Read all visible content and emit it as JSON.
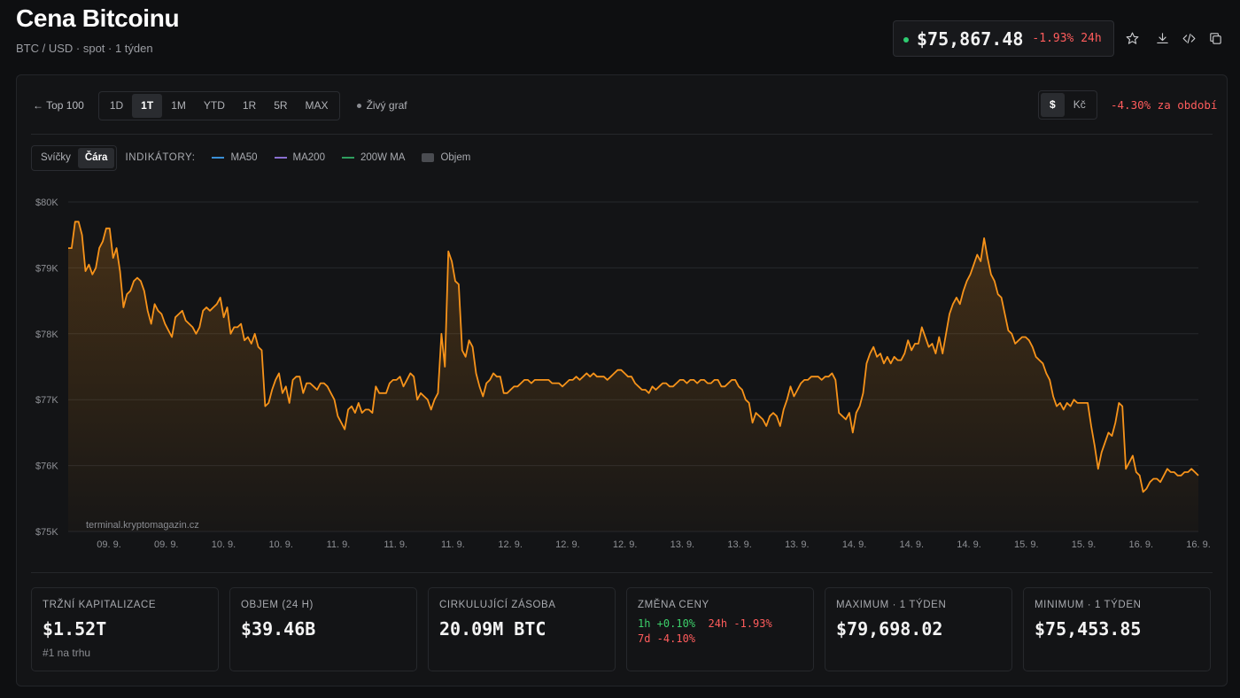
{
  "header": {
    "title": "Cena Bitcoinu",
    "subtitle": "BTC / USD · spot · 1 týden",
    "price": "$75,867.48",
    "change_24h": "-1.93% 24h"
  },
  "toolbar": {
    "back_label": "← Top 100",
    "ranges": [
      "1D",
      "1T",
      "1M",
      "YTD",
      "1R",
      "5R",
      "MAX"
    ],
    "active_range": "1T",
    "live_label": "Živý graf",
    "currencies": [
      "$",
      "Kč"
    ],
    "active_currency": "$",
    "period_change": "-4.30% za období"
  },
  "chart_toolbar": {
    "modes": [
      "Svíčky",
      "Čára"
    ],
    "active_mode": "Čára",
    "indicators_label": "INDIKÁTORY:",
    "indicators": [
      {
        "name": "MA50",
        "color": "#3a8fd6"
      },
      {
        "name": "MA200",
        "color": "#8a6fd0"
      },
      {
        "name": "200W MA",
        "color": "#2e9e5e"
      },
      {
        "name": "Objem",
        "color": "#4a4c51"
      }
    ]
  },
  "colors": {
    "line": "#f7931a",
    "accent_positive": "#3ccf6a",
    "accent_negative": "#ff5c5c"
  },
  "chart_data": {
    "type": "line",
    "watermark": "terminal.kryptomagazin.cz",
    "ylim": [
      75000,
      80000
    ],
    "y_ticks": [
      80000,
      79000,
      78000,
      77000,
      76000,
      75000
    ],
    "y_tick_labels": [
      "$80K",
      "$79K",
      "$78K",
      "$77K",
      "$76K",
      "$75K"
    ],
    "x_tick_labels": [
      "09. 9.",
      "09. 9.",
      "10. 9.",
      "10. 9.",
      "11. 9.",
      "11. 9.",
      "11. 9.",
      "12. 9.",
      "12. 9.",
      "12. 9.",
      "13. 9.",
      "13. 9.",
      "13. 9.",
      "14. 9.",
      "14. 9.",
      "14. 9.",
      "15. 9.",
      "15. 9.",
      "16. 9.",
      "16. 9."
    ],
    "grid": true,
    "series": [
      {
        "values": [
          79300,
          79300,
          79700,
          79700,
          79500,
          78950,
          79050,
          78900,
          79000,
          79300,
          79400,
          79600,
          79600,
          79150,
          79300,
          78950,
          78400,
          78600,
          78650,
          78800,
          78850,
          78800,
          78650,
          78350,
          78150,
          78450,
          78350,
          78300,
          78150,
          78050,
          77950,
          78250,
          78300,
          78350,
          78200,
          78150,
          78100,
          78000,
          78100,
          78350,
          78400,
          78350,
          78400,
          78450,
          78550,
          78250,
          78400,
          78000,
          78100,
          78100,
          78150,
          77900,
          77950,
          77850,
          78000,
          77800,
          77750,
          76900,
          76950,
          77150,
          77300,
          77400,
          77100,
          77200,
          76950,
          77300,
          77350,
          77350,
          77100,
          77250,
          77250,
          77200,
          77150,
          77250,
          77250,
          77200,
          77100,
          77000,
          76750,
          76650,
          76550,
          76850,
          76900,
          76800,
          76950,
          76800,
          76850,
          76850,
          76800,
          77200,
          77100,
          77100,
          77100,
          77250,
          77300,
          77300,
          77350,
          77200,
          77300,
          77400,
          77350,
          77000,
          77100,
          77050,
          77000,
          76850,
          77000,
          77100,
          78000,
          77500,
          79250,
          79100,
          78800,
          78750,
          77750,
          77650,
          77900,
          77800,
          77400,
          77200,
          77050,
          77250,
          77300,
          77400,
          77350,
          77350,
          77100,
          77100,
          77150,
          77200,
          77200,
          77250,
          77300,
          77300,
          77250,
          77300,
          77300,
          77300,
          77300,
          77300,
          77250,
          77250,
          77250,
          77200,
          77250,
          77300,
          77300,
          77350,
          77300,
          77350,
          77400,
          77350,
          77400,
          77350,
          77350,
          77350,
          77300,
          77350,
          77400,
          77450,
          77450,
          77400,
          77350,
          77350,
          77250,
          77200,
          77150,
          77150,
          77100,
          77200,
          77150,
          77200,
          77250,
          77250,
          77200,
          77200,
          77250,
          77300,
          77300,
          77250,
          77300,
          77300,
          77250,
          77300,
          77300,
          77250,
          77250,
          77300,
          77300,
          77200,
          77200,
          77250,
          77300,
          77300,
          77200,
          77150,
          77000,
          76950,
          76650,
          76800,
          76750,
          76700,
          76600,
          76750,
          76800,
          76750,
          76600,
          76850,
          77000,
          77200,
          77050,
          77150,
          77250,
          77300,
          77300,
          77350,
          77350,
          77350,
          77300,
          77350,
          77350,
          77400,
          77300,
          76800,
          76750,
          76700,
          76800,
          76500,
          76800,
          76900,
          77100,
          77550,
          77700,
          77800,
          77650,
          77700,
          77550,
          77650,
          77550,
          77650,
          77600,
          77600,
          77700,
          77900,
          77750,
          77850,
          77850,
          78100,
          77950,
          77800,
          77850,
          77700,
          77950,
          77700,
          78000,
          78300,
          78450,
          78550,
          78450,
          78650,
          78800,
          78900,
          79050,
          79200,
          79100,
          79450,
          79150,
          78900,
          78800,
          78600,
          78550,
          78300,
          78050,
          78000,
          77850,
          77900,
          77950,
          77950,
          77900,
          77800,
          77650,
          77600,
          77550,
          77400,
          77300,
          77050,
          76900,
          76950,
          76850,
          76950,
          76900,
          77000,
          76950,
          76950,
          76950,
          76950,
          76600,
          76300,
          75950,
          76200,
          76350,
          76500,
          76450,
          76650,
          76950,
          76900,
          75950,
          76050,
          76150,
          75900,
          75850,
          75600,
          75650,
          75750,
          75800,
          75800,
          75750,
          75850,
          75950,
          75900,
          75900,
          75850,
          75850,
          75900,
          75900,
          75950,
          75900,
          75850
        ]
      }
    ]
  },
  "stats": [
    {
      "label": "TRŽNÍ KAPITALIZACE",
      "value": "$1.52T",
      "sub": "#1 na trhu"
    },
    {
      "label": "OBJEM (24 H)",
      "value": "$39.46B"
    },
    {
      "label": "CIRKULUJÍCÍ ZÁSOBA",
      "value": "20.09M BTC"
    },
    {
      "label": "ZMĚNA CENY",
      "changes": {
        "h1": "1h +0.10%",
        "h24": "24h -1.93%",
        "d7": "7d -4.10%"
      }
    },
    {
      "label": "MAXIMUM · 1 TÝDEN",
      "value": "$79,698.02"
    },
    {
      "label": "MINIMUM · 1 TÝDEN",
      "value": "$75,453.85"
    }
  ]
}
